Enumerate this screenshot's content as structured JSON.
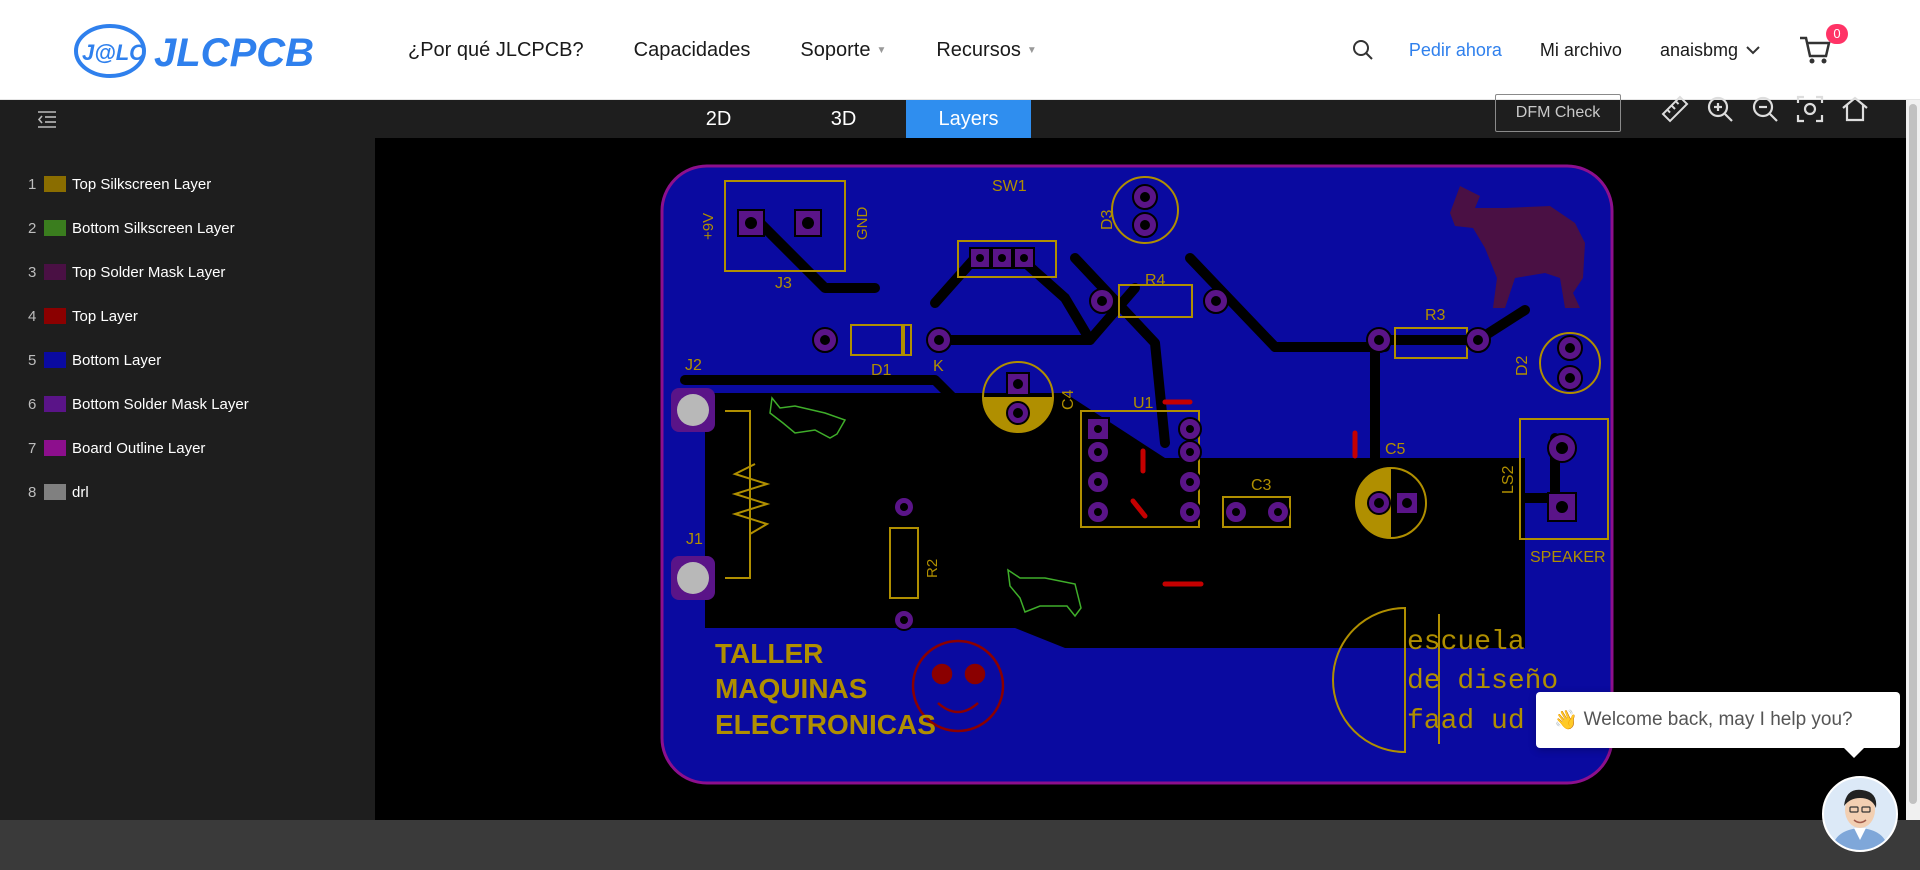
{
  "brand": {
    "logo_text": "JLCPCB",
    "logo_mark": "J@LC"
  },
  "nav": {
    "items": [
      {
        "label": "¿Por qué JLCPCB?"
      },
      {
        "label": "Capacidades"
      },
      {
        "label": "Soporte",
        "has_dropdown": true
      },
      {
        "label": "Recursos",
        "has_dropdown": true
      }
    ],
    "order_label": "Pedir ahora",
    "files_label": "Mi archivo",
    "user_label": "anaisbmg",
    "cart_count": "0"
  },
  "viewer": {
    "tabs": [
      {
        "label": "2D",
        "active": false
      },
      {
        "label": "3D",
        "active": false
      },
      {
        "label": "Layers",
        "active": true
      }
    ],
    "dfm_label": "DFM Check",
    "tools": [
      "ruler-icon",
      "zoom-in-icon",
      "zoom-out-icon",
      "fit-view-icon",
      "home-icon"
    ]
  },
  "layers": [
    {
      "num": "1",
      "name": "Top Silkscreen Layer",
      "color": "#8a6d00"
    },
    {
      "num": "2",
      "name": "Bottom Silkscreen Layer",
      "color": "#3a7d1e"
    },
    {
      "num": "3",
      "name": "Top Solder Mask Layer",
      "color": "#4a1044"
    },
    {
      "num": "4",
      "name": "Top Layer",
      "color": "#8b0000"
    },
    {
      "num": "5",
      "name": "Bottom Layer",
      "color": "#0a0aa0"
    },
    {
      "num": "6",
      "name": "Bottom Solder Mask Layer",
      "color": "#5a1488"
    },
    {
      "num": "7",
      "name": "Board Outline Layer",
      "color": "#8d0f8d"
    },
    {
      "num": "8",
      "name": "drl",
      "color": "#808080"
    }
  ],
  "board": {
    "labels": {
      "sw1": "SW1",
      "d3": "D3",
      "j3": "J3",
      "plus9v": "+9V",
      "gnd": "GND",
      "r4": "R4",
      "d1": "D1",
      "k": "K",
      "r3": "R3",
      "d2": "D2",
      "j2": "J2",
      "c4": "C4",
      "u1": "U1",
      "c5": "C5",
      "c3": "C3",
      "ls2": "LS2",
      "speaker": "SPEAKER",
      "j1": "J1",
      "r2": "R2",
      "title1": "TALLER",
      "title2": "MAQUINAS",
      "title3": "ELECTRONICAS",
      "school1": "escuela",
      "school2": "de diseño",
      "school3": "faad ud"
    }
  },
  "chat": {
    "message": "Welcome back, may I help you?",
    "wave": "👋"
  },
  "colors": {
    "accent": "#2f8eef",
    "board_fill": "#0a0aa0",
    "silk": "#b08f00",
    "outline": "#8d0f8d"
  }
}
